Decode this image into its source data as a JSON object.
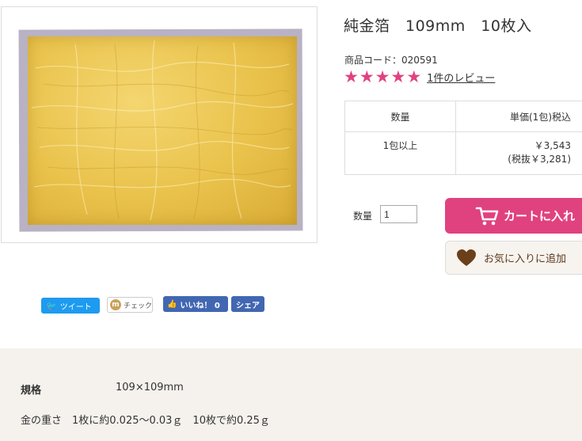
{
  "product": {
    "title": "純金箔　109mm　10枚入",
    "code": "商品コード：020591"
  },
  "rating": {
    "stars": 5,
    "star_glyph": "★",
    "star_color": "#e0427f",
    "review_link": "1件のレビュー"
  },
  "price_table": {
    "headers": [
      "数量",
      "単価(1包)税込"
    ],
    "rows": [
      {
        "qty": "1包以上",
        "price": "￥3,543",
        "price_ex_tax": "(税抜￥3,281)"
      }
    ]
  },
  "order": {
    "qty_label": "数量",
    "qty_value": "1",
    "cart_button": "カートに入れ",
    "favorite_button": "お気に入りに追加"
  },
  "social": {
    "tweet": "ツイート",
    "check": "チェック",
    "check_logo": "m",
    "like": "いいね！ 0",
    "share": "シェア"
  },
  "spec": {
    "label": "規格",
    "size": "109×109mm",
    "weight": "金の重さ　1枚に約0.025～0.03ｇ　10枚で約0.25ｇ"
  },
  "colors": {
    "accent": "#e0427f",
    "favorite_text": "#5b3a1c",
    "facebook": "#4267b2",
    "twitter": "#1d9bf0",
    "spec_background": "#f5f2ee"
  },
  "icons": {
    "cart": "cart-icon",
    "heart": "heart-icon",
    "bird": "twitter-bird-icon",
    "thumb": "thumbs-up-icon"
  }
}
